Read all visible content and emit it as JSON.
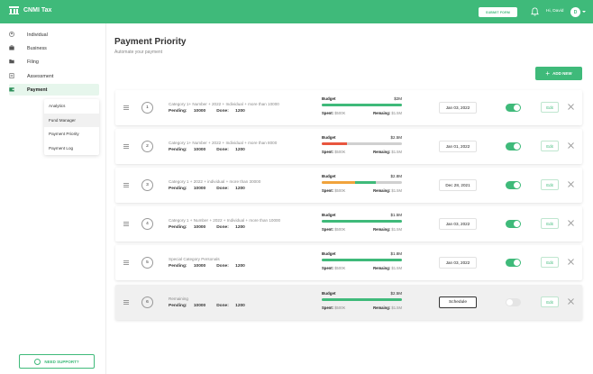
{
  "header": {
    "logo_text": "CNMI Tax",
    "submit_label": "SUBMIT FORM",
    "greeting": "Hi, David",
    "avatar_initial": "D"
  },
  "sidebar": {
    "items": [
      {
        "label": "Individual",
        "icon": "user-circle-icon"
      },
      {
        "label": "Business",
        "icon": "briefcase-icon"
      },
      {
        "label": "Filing",
        "icon": "folder-icon"
      },
      {
        "label": "Assessment",
        "icon": "clipboard-icon"
      },
      {
        "label": "Payment",
        "icon": "wallet-icon",
        "active": true
      }
    ],
    "submenu": [
      {
        "label": "Analytics"
      },
      {
        "label": "Fund Manager",
        "active": true
      },
      {
        "label": "Payment Priority"
      },
      {
        "label": "Payment Log"
      }
    ],
    "support_label": "NEED SUPPORT?"
  },
  "main": {
    "title": "Payment Priority",
    "subtitle": "Automate your payment",
    "add_label": "ADD NEW"
  },
  "labels": {
    "pending": "Pending:",
    "done": "Done:",
    "budget": "Budget",
    "spent": "Spent:",
    "remaining": "Remaing:",
    "edit": "Edit",
    "schedule": "Schedule"
  },
  "colors": {
    "accent": "#3fba7a",
    "bar_green": "#3fba7a",
    "bar_red": "#e8553e",
    "bar_orange": "#f0a33c",
    "bar_track": "#d0d0d0"
  },
  "rows": [
    {
      "num": "1",
      "desc": "Category 1+ Number + 2022 + Individual + more than 10000",
      "pending": "10000",
      "done": "1200",
      "budget": "$2M",
      "spent": "$500K",
      "remaining": "$1.5M",
      "date": "Jan 03, 2022",
      "toggle_on": true,
      "bar": [
        {
          "color": "#3fba7a",
          "fraction": 1
        }
      ]
    },
    {
      "num": "2",
      "desc": "Category 1+ Number + 2022 + Individual + more than 8000",
      "pending": "10000",
      "done": "1200",
      "budget": "$2.5M",
      "spent": "$500K",
      "remaining": "$1.5M",
      "date": "Jan 01, 2022",
      "toggle_on": true,
      "bar": [
        {
          "color": "#e8553e",
          "fraction": 0.32
        }
      ]
    },
    {
      "num": "3",
      "desc": "Category 1 + 2022 + individual + more than 30000",
      "pending": "10000",
      "done": "1200",
      "budget": "$2.8M",
      "spent": "$500K",
      "remaining": "$1.5M",
      "date": "Dec 28, 2021",
      "toggle_on": true,
      "bar": [
        {
          "color": "#f0a33c",
          "fraction": 0.42
        },
        {
          "color": "#3fba7a",
          "fraction": 0.25
        }
      ]
    },
    {
      "num": "4",
      "desc": "Category 1 + Number + 2022 + Individual + more than 10000",
      "pending": "10000",
      "done": "1200",
      "budget": "$1.5M",
      "spent": "$500K",
      "remaining": "$1.5M",
      "date": "Jan 03, 2022",
      "toggle_on": true,
      "bar": [
        {
          "color": "#3fba7a",
          "fraction": 1
        }
      ]
    },
    {
      "num": "5",
      "desc": "Special Category Personals",
      "pending": "10000",
      "done": "1200",
      "budget": "$1.8M",
      "spent": "$500K",
      "remaining": "$1.5M",
      "date": "Jan 03, 2022",
      "toggle_on": true,
      "bar": [
        {
          "color": "#3fba7a",
          "fraction": 1
        }
      ]
    },
    {
      "num": "6",
      "desc": "Remaining",
      "pending": "10000",
      "done": "1200",
      "budget": "$2.5M",
      "spent": "$500K",
      "remaining": "$1.5M",
      "date": "",
      "schedule": true,
      "toggle_on": false,
      "muted": true,
      "bar": [
        {
          "color": "#3fba7a",
          "fraction": 1
        }
      ]
    }
  ]
}
